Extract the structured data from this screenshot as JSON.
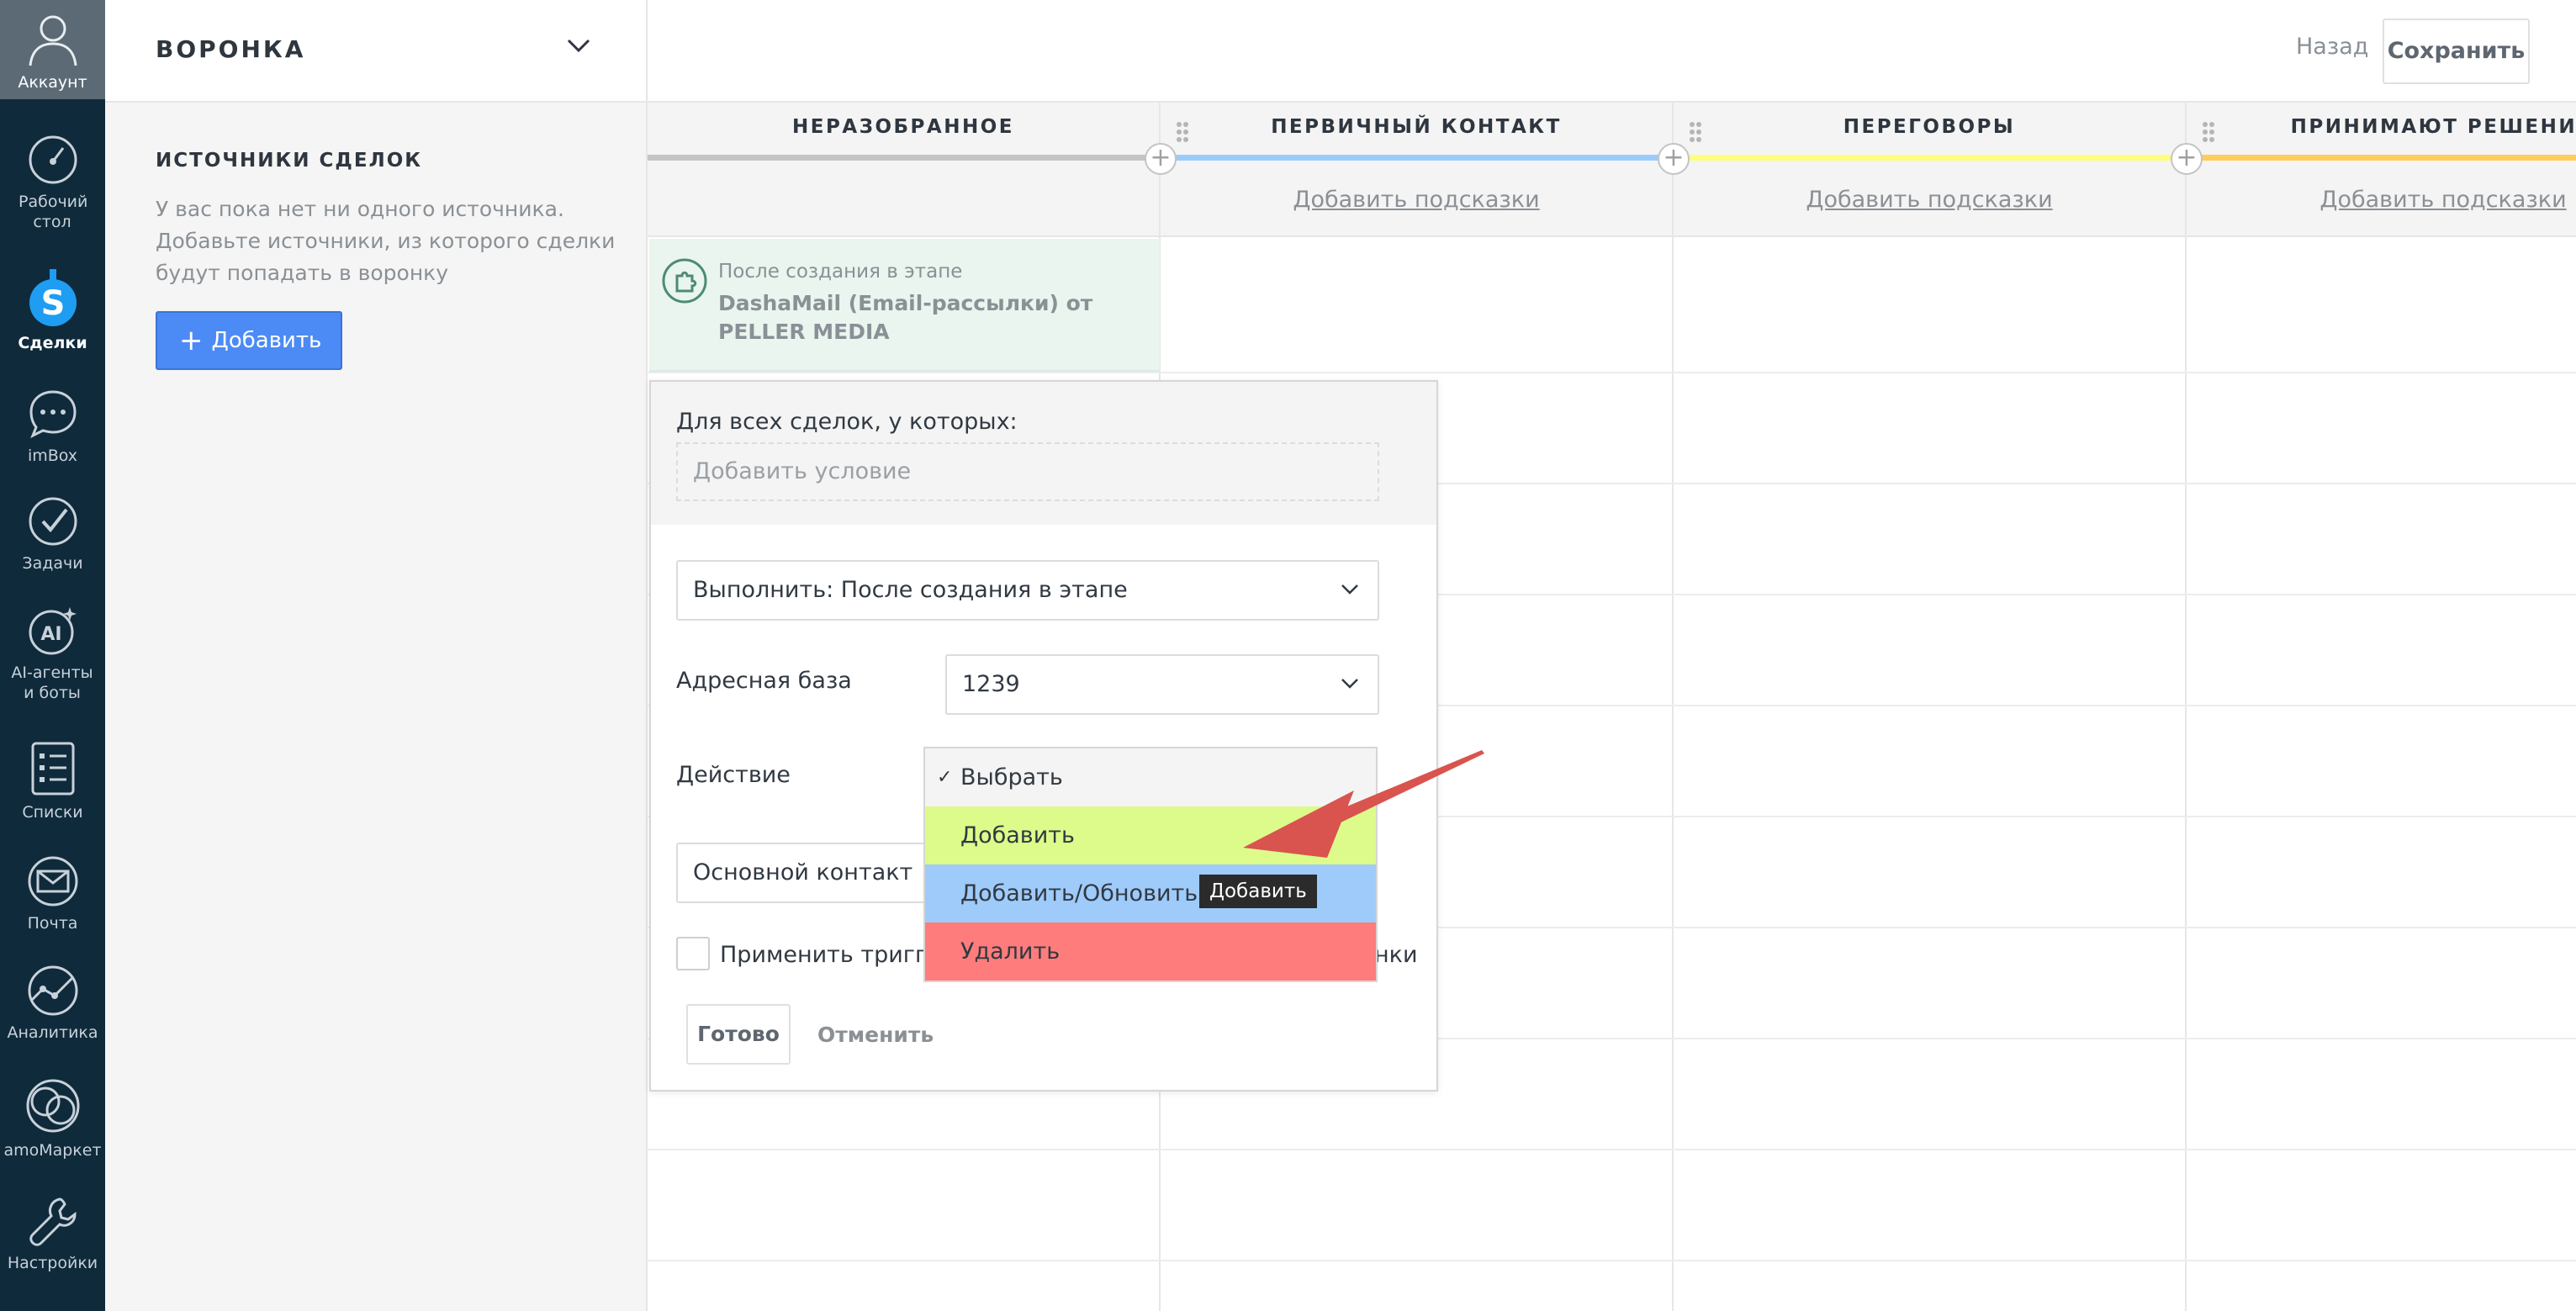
{
  "nav": {
    "account": "Аккаунт",
    "dashboard": "Рабочий стол",
    "deals": "Сделки",
    "imbox": "imBox",
    "tasks": "Задачи",
    "ai": "AI-агенты и боты",
    "lists": "Списки",
    "mail": "Почта",
    "analytics": "Аналитика",
    "market": "amoМаркет",
    "settings": "Настройки"
  },
  "left_panel": {
    "funnel_title": "ВОРОНКА",
    "sources_title": "ИСТОЧНИКИ СДЕЛОК",
    "sources_text": "У вас пока нет ни одного источника. Добавьте источники, из которого сделки будут попадать в воронку",
    "add_button": "Добавить",
    "add_button_icon": "+"
  },
  "topbar": {
    "back": "Назад",
    "save": "Сохранить"
  },
  "columns": [
    {
      "title": "НЕРАЗОБРАННОЕ",
      "color": "#c4c4c4",
      "hint": ""
    },
    {
      "title": "ПЕРВИЧНЫЙ КОНТАКТ",
      "color": "#99ccfd",
      "hint": "Добавить подсказки"
    },
    {
      "title": "ПЕРЕГОВОРЫ",
      "color": "#fffd7f",
      "hint": "Добавить подсказки"
    },
    {
      "title": "ПРИНИМАЮТ РЕШЕНИЕ",
      "color": "#ffce5a",
      "hint": "Добавить подсказки"
    }
  ],
  "plus_symbol": "+",
  "trigger": {
    "pre": "После создания в этапе",
    "name": "DashaMail (Email-рассылки) от PELLER MEDIA"
  },
  "popup": {
    "condition_label": "Для всех сделок, у которых:",
    "condition_add": "Добавить условие",
    "execute": "Выполнить: После создания в этапе",
    "address_label": "Адресная база",
    "address_value": "1239",
    "action_label": "Действие",
    "contact_value": "Основной контакт",
    "apply_label": "Применить триггер",
    "apply_label_tail": "нки",
    "done": "Готово",
    "cancel": "Отменить"
  },
  "dropdown": {
    "check": "✓",
    "options": [
      "Выбрать",
      "Добавить",
      "Добавить/Обновить",
      "Удалить"
    ],
    "selected": "Выбрать"
  },
  "tooltip": "Добавить",
  "colors": {
    "nav_bg": "#0f2a3b",
    "primary": "#4c8bf5",
    "option_add": "#dcfb8a",
    "option_update": "#9ecbfa",
    "option_delete": "#ff7c7c",
    "arrow": "#d9534f"
  }
}
